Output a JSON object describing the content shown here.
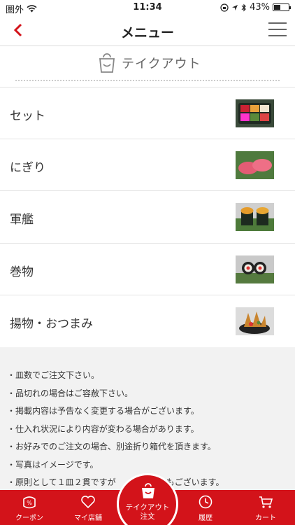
{
  "status_bar": {
    "carrier": "圏外",
    "time": "11:34",
    "battery": "43%",
    "battery_level": 0.43
  },
  "nav": {
    "title": "メニュー"
  },
  "section": {
    "label": "テイクアウト"
  },
  "menu_items": [
    {
      "label": "セット",
      "thumb": "set-platter"
    },
    {
      "label": "にぎり",
      "thumb": "nigiri"
    },
    {
      "label": "軍艦",
      "thumb": "gunkan"
    },
    {
      "label": "巻物",
      "thumb": "makimono"
    },
    {
      "label": "揚物・おつまみ",
      "thumb": "fried-snack"
    }
  ],
  "notes": [
    "・皿数でご注文下さい。",
    "・品切れの場合はご容赦下さい。",
    "・掲載内容は予告なく変更する場合がございます。",
    "・仕入れ状況により内容が変わる場合があります。",
    "・お好みでのご注文の場合、別途折り箱代を頂きます。",
    "・写真はイメージです。",
    "・原則として１皿２貫ですが　　　　　　もございます。"
  ],
  "tabs": {
    "coupon": "クーポン",
    "my_store": "マイ店舗",
    "takeout_order": "テイクアウト\n注文",
    "history": "履歴",
    "cart": "カート"
  },
  "colors": {
    "brand": "#d3131a",
    "notes_bg": "#f2f2f2"
  }
}
